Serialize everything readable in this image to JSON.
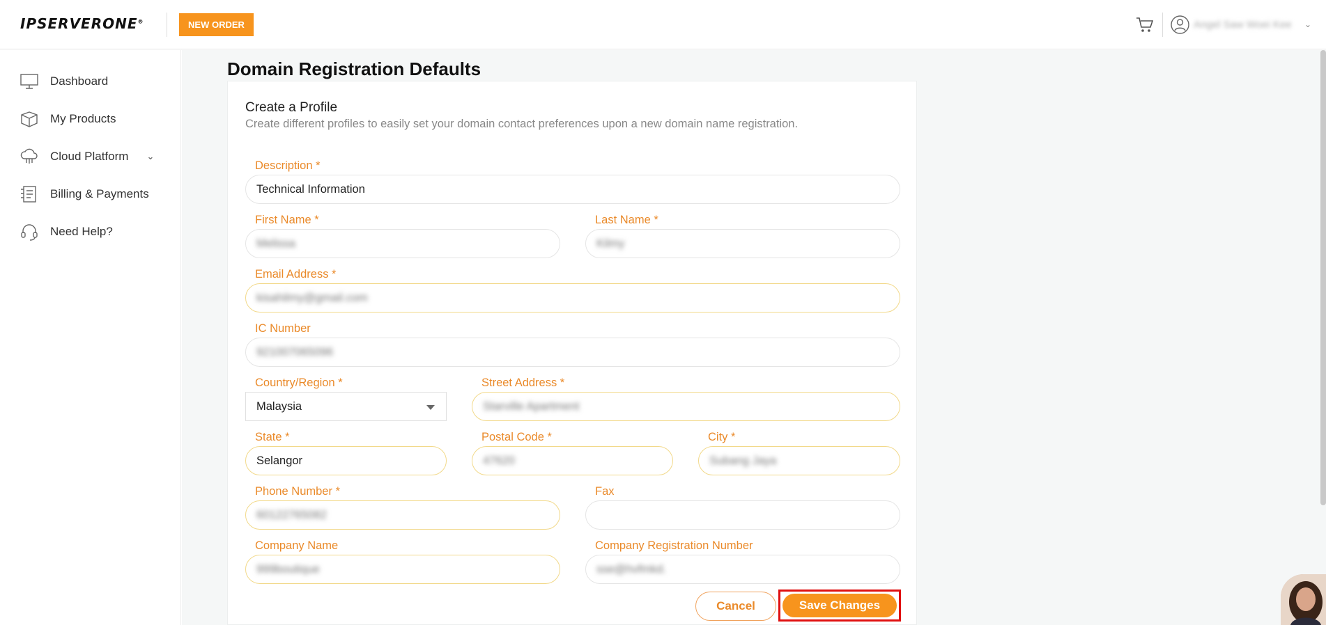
{
  "header": {
    "logo": "IPSERVERONE",
    "new_order_label": "NEW ORDER",
    "user_name": "Angel Saw Woei Kee"
  },
  "sidebar": {
    "items": [
      {
        "label": "Dashboard",
        "icon": "monitor-icon"
      },
      {
        "label": "My Products",
        "icon": "box-icon"
      },
      {
        "label": "Cloud Platform",
        "icon": "cloud-icon"
      },
      {
        "label": "Billing & Payments",
        "icon": "receipt-icon"
      },
      {
        "label": "Need Help?",
        "icon": "headset-icon"
      }
    ]
  },
  "page": {
    "title": "Domain Registration Defaults",
    "card_title": "Create a Profile",
    "card_desc": "Create different profiles to easily set your domain contact preferences upon a new domain name registration."
  },
  "form": {
    "description": {
      "label": "Description *",
      "value": "Technical Information"
    },
    "first_name": {
      "label": "First Name *",
      "value": "Melissa"
    },
    "last_name": {
      "label": "Last Name *",
      "value": "Kilmy"
    },
    "email": {
      "label": "Email Address *",
      "value": "kisahilmy@gmail.com"
    },
    "ic_number": {
      "label": "IC Number",
      "value": "921007065096"
    },
    "country": {
      "label": "Country/Region *",
      "value": "Malaysia"
    },
    "street": {
      "label": "Street Address *",
      "value": "Starville Apartment"
    },
    "state": {
      "label": "State *",
      "value": "Selangor"
    },
    "postal": {
      "label": "Postal Code *",
      "value": "47620"
    },
    "city": {
      "label": "City *",
      "value": "Subang Jaya"
    },
    "phone": {
      "label": "Phone Number *",
      "value": "60122765082"
    },
    "fax": {
      "label": "Fax",
      "value": ""
    },
    "company": {
      "label": "Company Name",
      "value": "999boutique"
    },
    "company_reg": {
      "label": "Company Registration Number",
      "value": "sse@hvfmkd."
    }
  },
  "buttons": {
    "cancel": "Cancel",
    "save": "Save Changes"
  },
  "colors": {
    "accent": "#f7941d",
    "label": "#ea8a2a",
    "highlight": "#e01010"
  }
}
